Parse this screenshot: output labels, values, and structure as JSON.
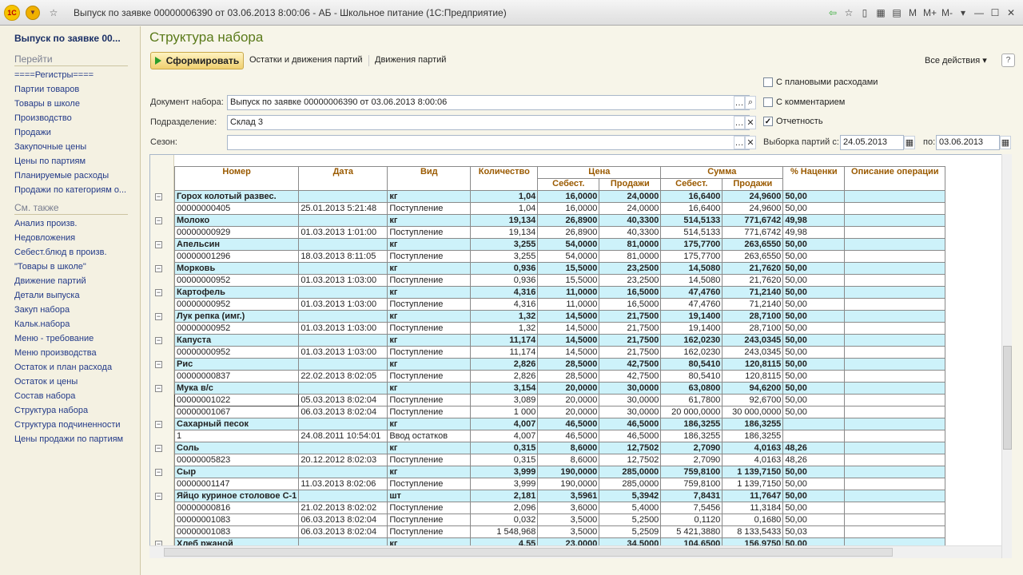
{
  "window": {
    "title": "Выпуск по заявке 00000006390 от 03.06.2013 8:00:06 - АБ - Школьное питание (1С:Предприятие)",
    "logo": "1С",
    "right_icons": [
      "M",
      "M+",
      "M-"
    ]
  },
  "sidebar": {
    "title": "Выпуск по заявке 00...",
    "goto_header": "Перейти",
    "goto_items": [
      "====Регистры====",
      "Партии товаров",
      "Товары в школе",
      "Производство",
      "Продажи",
      "Закупочные цены",
      "Цены по партиям",
      "Планируемые расходы",
      "Продажи по категориям о..."
    ],
    "seealso_header": "См. также",
    "seealso_items": [
      "Анализ произв.",
      "Недовложения",
      "Себест.блюд в произв.",
      "\"Товары в школе\"",
      "Движение партий",
      "Детали выпуска",
      "Закуп набора",
      "Кальк.набора",
      "Меню - требование",
      "Меню производства",
      "Остаток и план расхода",
      "Остаток и цены",
      "Состав набора",
      "Структура набора",
      "Структура подчиненности",
      "Цены продажи по партиям"
    ]
  },
  "main": {
    "title": "Структура набора",
    "form_button": "Сформировать",
    "link1": "Остатки и движения партий",
    "link2": "Движения партий",
    "all_actions": "Все действия ▾",
    "help": "?",
    "doc_label": "Документ набора:",
    "doc_value": "Выпуск по заявке 00000006390 от 03.06.2013 8:00:06",
    "dept_label": "Подразделение:",
    "dept_value": "Склад 3",
    "season_label": "Сезон:",
    "season_value": "",
    "chk_planned": "С плановыми расходами",
    "chk_planned_checked": false,
    "chk_comment": "С комментарием",
    "chk_comment_checked": false,
    "chk_report": "Отчетность",
    "chk_report_checked": true,
    "batch_from_label": "Выборка партий с:",
    "batch_from": "24.05.2013",
    "batch_to_label": "по:",
    "batch_to": "03.06.2013"
  },
  "table": {
    "headers": {
      "num": "Номер",
      "date": "Дата",
      "kind": "Вид",
      "qty": "Количество",
      "price": "Цена",
      "sum": "Сумма",
      "cost": "Себест.",
      "sales": "Продажи",
      "markup": "% Наценки",
      "desc": "Описание операции"
    },
    "rows": [
      {
        "g": true,
        "c": [
          "Горох колотый развес.",
          "",
          "кг",
          "1,04",
          "16,0000",
          "24,0000",
          "16,6400",
          "24,9600",
          "50,00",
          ""
        ]
      },
      {
        "g": false,
        "c": [
          "00000000405",
          "25.01.2013 5:21:48",
          "Поступление",
          "1,04",
          "16,0000",
          "24,0000",
          "16,6400",
          "24,9600",
          "50,00",
          ""
        ]
      },
      {
        "g": true,
        "c": [
          "Молоко",
          "",
          "кг",
          "19,134",
          "26,8900",
          "40,3300",
          "514,5133",
          "771,6742",
          "49,98",
          ""
        ]
      },
      {
        "g": false,
        "c": [
          "00000000929",
          "01.03.2013 1:01:00",
          "Поступление",
          "19,134",
          "26,8900",
          "40,3300",
          "514,5133",
          "771,6742",
          "49,98",
          ""
        ]
      },
      {
        "g": true,
        "c": [
          "Апельсин",
          "",
          "кг",
          "3,255",
          "54,0000",
          "81,0000",
          "175,7700",
          "263,6550",
          "50,00",
          ""
        ]
      },
      {
        "g": false,
        "c": [
          "00000001296",
          "18.03.2013 8:11:05",
          "Поступление",
          "3,255",
          "54,0000",
          "81,0000",
          "175,7700",
          "263,6550",
          "50,00",
          ""
        ]
      },
      {
        "g": true,
        "c": [
          "Морковь",
          "",
          "кг",
          "0,936",
          "15,5000",
          "23,2500",
          "14,5080",
          "21,7620",
          "50,00",
          ""
        ]
      },
      {
        "g": false,
        "c": [
          "00000000952",
          "01.03.2013 1:03:00",
          "Поступление",
          "0,936",
          "15,5000",
          "23,2500",
          "14,5080",
          "21,7620",
          "50,00",
          ""
        ]
      },
      {
        "g": true,
        "c": [
          "Картофель",
          "",
          "кг",
          "4,316",
          "11,0000",
          "16,5000",
          "47,4760",
          "71,2140",
          "50,00",
          ""
        ]
      },
      {
        "g": false,
        "c": [
          "00000000952",
          "01.03.2013 1:03:00",
          "Поступление",
          "4,316",
          "11,0000",
          "16,5000",
          "47,4760",
          "71,2140",
          "50,00",
          ""
        ]
      },
      {
        "g": true,
        "c": [
          "Лук репка (имг.)",
          "",
          "кг",
          "1,32",
          "14,5000",
          "21,7500",
          "19,1400",
          "28,7100",
          "50,00",
          ""
        ]
      },
      {
        "g": false,
        "c": [
          "00000000952",
          "01.03.2013 1:03:00",
          "Поступление",
          "1,32",
          "14,5000",
          "21,7500",
          "19,1400",
          "28,7100",
          "50,00",
          ""
        ]
      },
      {
        "g": true,
        "c": [
          "Капуста",
          "",
          "кг",
          "11,174",
          "14,5000",
          "21,7500",
          "162,0230",
          "243,0345",
          "50,00",
          ""
        ]
      },
      {
        "g": false,
        "c": [
          "00000000952",
          "01.03.2013 1:03:00",
          "Поступление",
          "11,174",
          "14,5000",
          "21,7500",
          "162,0230",
          "243,0345",
          "50,00",
          ""
        ]
      },
      {
        "g": true,
        "c": [
          "Рис",
          "",
          "кг",
          "2,826",
          "28,5000",
          "42,7500",
          "80,5410",
          "120,8115",
          "50,00",
          ""
        ]
      },
      {
        "g": false,
        "c": [
          "00000000837",
          "22.02.2013 8:02:05",
          "Поступление",
          "2,826",
          "28,5000",
          "42,7500",
          "80,5410",
          "120,8115",
          "50,00",
          ""
        ]
      },
      {
        "g": true,
        "c": [
          "Мука в/с",
          "",
          "кг",
          "3,154",
          "20,0000",
          "30,0000",
          "63,0800",
          "94,6200",
          "50,00",
          ""
        ]
      },
      {
        "g": false,
        "c": [
          "00000001022",
          "05.03.2013 8:02:04",
          "Поступление",
          "3,089",
          "20,0000",
          "30,0000",
          "61,7800",
          "92,6700",
          "50,00",
          ""
        ]
      },
      {
        "g": false,
        "c": [
          "00000001067",
          "06.03.2013 8:02:04",
          "Поступление",
          "1 000",
          "20,0000",
          "30,0000",
          "20 000,0000",
          "30 000,0000",
          "50,00",
          ""
        ]
      },
      {
        "g": true,
        "c": [
          "Сахарный песок",
          "",
          "кг",
          "4,007",
          "46,5000",
          "46,5000",
          "186,3255",
          "186,3255",
          "",
          ""
        ]
      },
      {
        "g": false,
        "c": [
          "1",
          "24.08.2011 10:54:01",
          "Ввод остатков",
          "4,007",
          "46,5000",
          "46,5000",
          "186,3255",
          "186,3255",
          "",
          ""
        ]
      },
      {
        "g": true,
        "c": [
          "Соль",
          "",
          "кг",
          "0,315",
          "8,6000",
          "12,7502",
          "2,7090",
          "4,0163",
          "48,26",
          ""
        ]
      },
      {
        "g": false,
        "c": [
          "00000005823",
          "20.12.2012 8:02:03",
          "Поступление",
          "0,315",
          "8,6000",
          "12,7502",
          "2,7090",
          "4,0163",
          "48,26",
          ""
        ]
      },
      {
        "g": true,
        "c": [
          "Сыр",
          "",
          "кг",
          "3,999",
          "190,0000",
          "285,0000",
          "759,8100",
          "1 139,7150",
          "50,00",
          ""
        ]
      },
      {
        "g": false,
        "c": [
          "00000001147",
          "11.03.2013 8:02:06",
          "Поступление",
          "3,999",
          "190,0000",
          "285,0000",
          "759,8100",
          "1 139,7150",
          "50,00",
          ""
        ]
      },
      {
        "g": true,
        "c": [
          "Яйцо куриное столовое С-1",
          "",
          "шт",
          "2,181",
          "3,5961",
          "5,3942",
          "7,8431",
          "11,7647",
          "50,00",
          ""
        ]
      },
      {
        "g": false,
        "c": [
          "00000000816",
          "21.02.2013 8:02:02",
          "Поступление",
          "2,096",
          "3,6000",
          "5,4000",
          "7,5456",
          "11,3184",
          "50,00",
          ""
        ]
      },
      {
        "g": false,
        "c": [
          "00000001083",
          "06.03.2013 8:02:04",
          "Поступление",
          "0,032",
          "3,5000",
          "5,2500",
          "0,1120",
          "0,1680",
          "50,00",
          ""
        ]
      },
      {
        "g": false,
        "c": [
          "00000001083",
          "06.03.2013 8:02:04",
          "Поступление",
          "1 548,968",
          "3,5000",
          "5,2509",
          "5 421,3880",
          "8 133,5433",
          "50,03",
          ""
        ]
      },
      {
        "g": true,
        "c": [
          "Хлеб ржаной",
          "",
          "кг",
          "4,55",
          "23,0000",
          "34,5000",
          "104,6500",
          "156,9750",
          "50,00",
          ""
        ]
      }
    ]
  }
}
